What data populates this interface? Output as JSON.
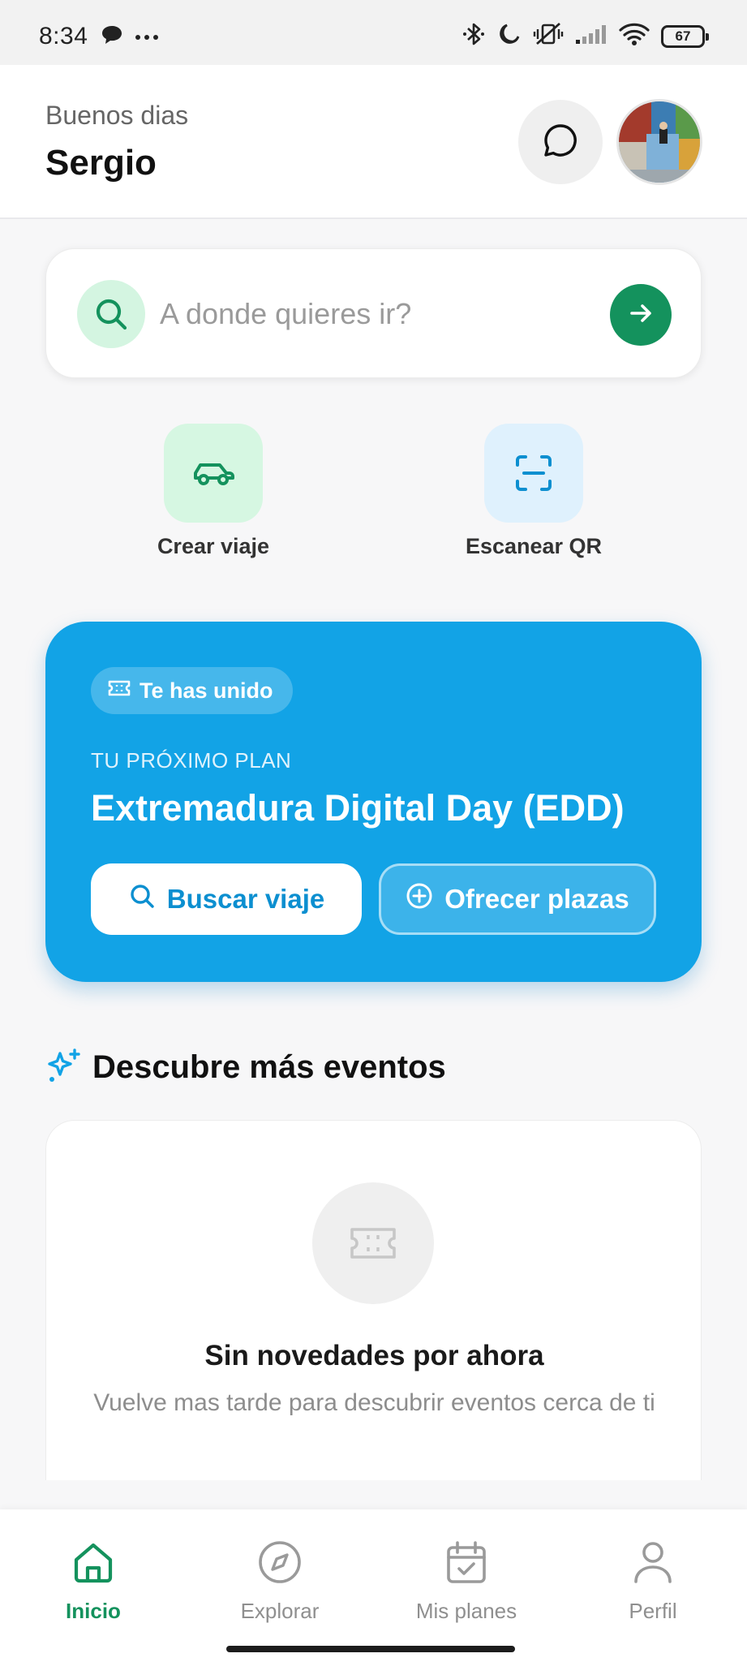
{
  "status_bar": {
    "time": "8:34",
    "battery": "67",
    "icons": [
      "chat-bubble-icon",
      "more-dots-icon",
      "bluetooth-icon",
      "moon-icon",
      "vibrate-off-icon",
      "signal-icon",
      "wifi-icon",
      "battery-icon"
    ]
  },
  "header": {
    "greeting": "Buenos dias",
    "name": "Sergio"
  },
  "search": {
    "placeholder": "A donde quieres ir?"
  },
  "quick_actions": [
    {
      "label": "Crear viaje",
      "icon": "car-icon",
      "color": "#14925d"
    },
    {
      "label": "Escanear QR",
      "icon": "scan-icon",
      "color": "#0c8fd0"
    }
  ],
  "plan": {
    "badge": "Te has unido",
    "kicker": "TU PRÓXIMO PLAN",
    "title": "Extremadura Digital Day (EDD)",
    "primary_button": "Buscar viaje",
    "secondary_button": "Ofrecer plazas",
    "color": "#12a3e6"
  },
  "discover": {
    "title": "Descubre más eventos",
    "empty_title": "Sin novedades por ahora",
    "empty_subtitle": "Vuelve mas tarde para descubrir eventos cerca de ti"
  },
  "nav": {
    "items": [
      {
        "label": "Inicio",
        "icon": "home-icon",
        "active": true
      },
      {
        "label": "Explorar",
        "icon": "compass-icon",
        "active": false
      },
      {
        "label": "Mis planes",
        "icon": "calendar-check-icon",
        "active": false
      },
      {
        "label": "Perfil",
        "icon": "user-icon",
        "active": false
      }
    ]
  },
  "colors": {
    "brand_green": "#14925d",
    "brand_blue": "#12a3e6"
  }
}
